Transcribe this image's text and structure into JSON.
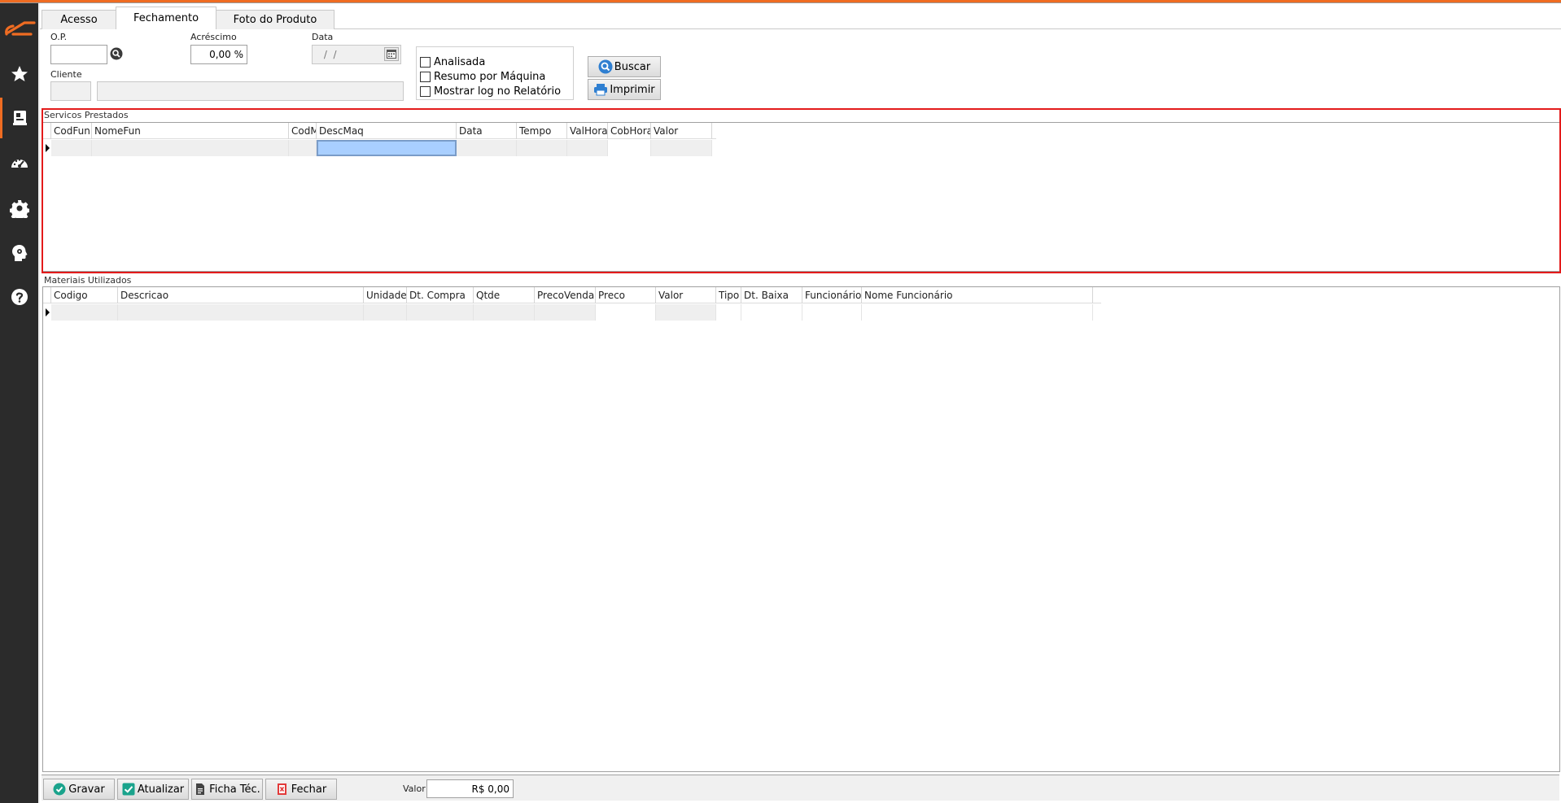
{
  "tabs": [
    {
      "label": "Acesso"
    },
    {
      "label": "Fechamento"
    },
    {
      "label": "Foto do Produto"
    }
  ],
  "form": {
    "op_label": "O.P.",
    "op_value": "",
    "acrescimo_label": "Acréscimo",
    "acrescimo_value": "0,00 %",
    "data_label": "Data",
    "data_value": " /  / ",
    "cliente_label": "Cliente",
    "cliente_code": "",
    "cliente_name": ""
  },
  "options": [
    {
      "label": "Analisada",
      "checked": false
    },
    {
      "label": "Resumo por Máquina",
      "checked": false
    },
    {
      "label": "Mostrar log no Relatório",
      "checked": false
    }
  ],
  "actions": {
    "buscar": "Buscar",
    "imprimir": "Imprimir"
  },
  "servicos": {
    "title": "Servicos Prestados",
    "columns": [
      "CodFun",
      "NomeFun",
      "CodM",
      "DescMaq",
      "Data",
      "Tempo",
      "ValHora",
      "CobHora",
      "Valor"
    ]
  },
  "materiais": {
    "title": "Materiais Utilizados",
    "columns": [
      "Codigo",
      "Descricao",
      "Unidade",
      "Dt. Compra",
      "Qtde",
      "PrecoVenda",
      "Preco",
      "Valor",
      "Tipo",
      "Dt. Baixa",
      "Funcionário",
      "Nome Funcionário"
    ]
  },
  "footer": {
    "gravar": "Gravar",
    "atualizar": "Atualizar",
    "ficha": "Ficha Téc.",
    "fechar": "Fechar",
    "valor_label": "Valor",
    "valor_value": "R$ 0,00"
  },
  "colors": {
    "accent": "#ef6c22",
    "highlight": "#e31b1b",
    "sidebar": "#2b2b2b"
  }
}
